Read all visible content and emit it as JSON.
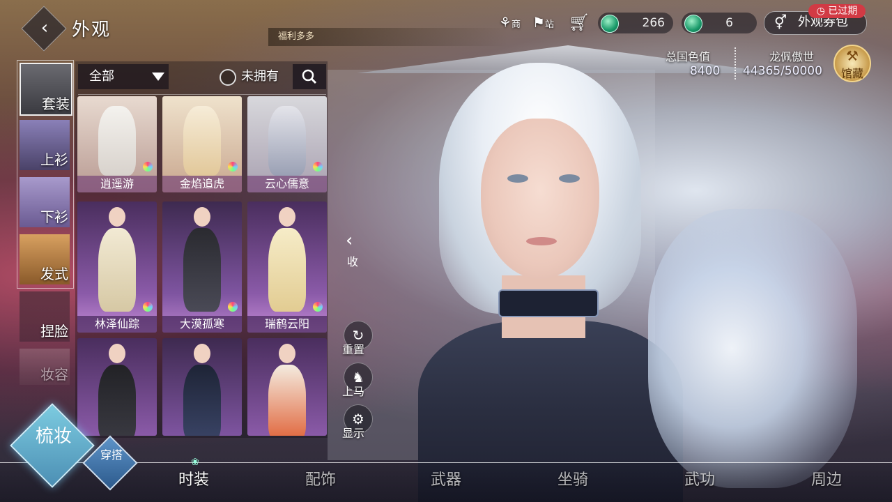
{
  "header": {
    "title": "外观",
    "ticker": "福利多多",
    "shop_label": "商",
    "station_label": "站",
    "currency_jade": "266",
    "currency_ticket": "6",
    "pack_label": "外观券包",
    "expired_badge": "已过期"
  },
  "stats": {
    "beauty_label": "总国色值",
    "beauty_value": "8400",
    "player_name": "龙佩傲世",
    "player_progress": "44365/50000",
    "museum_label": "馆藏"
  },
  "filter": {
    "category": "全部",
    "not_owned_label": "未拥有"
  },
  "categories": [
    {
      "label": "套装"
    },
    {
      "label": "上衫"
    },
    {
      "label": "下衫"
    },
    {
      "label": "发式"
    },
    {
      "label": "捏脸"
    },
    {
      "label": "妆容"
    }
  ],
  "outfits": [
    {
      "name": "逍遥游"
    },
    {
      "name": "金焰追虎"
    },
    {
      "name": "云心儒意"
    },
    {
      "name": "林泽仙踪"
    },
    {
      "name": "大漠孤寒"
    },
    {
      "name": "瑞鹤云阳"
    },
    {
      "name": ""
    },
    {
      "name": ""
    },
    {
      "name": ""
    }
  ],
  "side_actions": {
    "collapse": "收",
    "reset": "重置",
    "mount": "上马",
    "display": "显示"
  },
  "mode_buttons": {
    "groom": "梳妆",
    "outfit": "穿搭"
  },
  "tabs": [
    {
      "label": "时装"
    },
    {
      "label": "配饰"
    },
    {
      "label": "武器"
    },
    {
      "label": "坐骑"
    },
    {
      "label": "武功"
    },
    {
      "label": "周边"
    }
  ],
  "colors": {
    "expired_red": "#d23a44",
    "jade_green": "#1a9a6a",
    "diamond_blue": "#7ccbe0"
  }
}
